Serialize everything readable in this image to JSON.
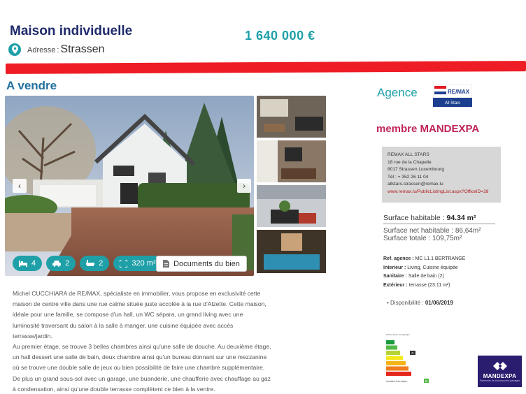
{
  "listing": {
    "title": "Maison individuelle",
    "price": "1 640 000 €",
    "address_label": "Adresse",
    "address_sep": ":",
    "address_value": "Strassen",
    "status": "A vendre"
  },
  "photo_nav": {
    "prev": "‹",
    "next": "›"
  },
  "features": {
    "bedrooms": "4",
    "cars": "2",
    "baths": "2",
    "area": "320 m²"
  },
  "documents_label": "Documents du bien",
  "description": [
    "Michel CUCCHIARA de RE/MAX, spécialiste en immobilier, vous propose en exclusivité cette",
    "maison de centre ville dans une rue calme située juste accolée à la rue d'Alzette. Cette maison,",
    "idéale pour une famille, se compose d'un hall, un WC sépara, un grand living avec une",
    "luminosité traversant du salon à la salle à manger, une cuisine équipée avec accès",
    "terrasse/jardin.",
    "Au premier étage, se trouve 3 belles chambres ainsi qu'une salle de douche. Au deuxième étage,",
    "un hall dessert une salle de bain, deux chambre ainsi qu'un bureau donnant sur une mezzanine",
    "où se trouve une double salle de jeux ou bien possibilité de faire une chambre supplémentaire.",
    "De plus un grand sous-sol avec un garage, une buanderie, une chaufferie avec chauffage au gaz",
    "à condensation, ainsi qu'une double terrasse complètent ce bien à la ventre."
  ],
  "agency": {
    "heading": "Agence",
    "logo_text_top": "RE/MAX",
    "logo_text_bottom": "All Stars",
    "membre": "membre MANDEXPA",
    "lines": [
      "REMAX ALL STARS",
      "18 rue de la Chapelle",
      "8017 Strassen Luxembourg",
      "Tél : + 352 26 11 04",
      "allstars.strassen@remax.lu"
    ],
    "url": "www.remax.lu/PublicListingList.aspx?OfficeID=28"
  },
  "surfaces": {
    "habitable_label": "Surface habitable :",
    "habitable_value": "94.34 m²",
    "net_label": "Surface net habitable : 86,64m²",
    "total_label": "Surface totale : 109,75m²"
  },
  "details": {
    "ref_key": "Ref. agence :",
    "ref_val": "MC L1.1 BERTRANGE",
    "int_key": "Interieur :",
    "int_val": "Living, Cuisine équipée",
    "san_key": "Sanitaire :",
    "san_val": "Salle de bain (2)",
    "ext_key": "Extérieur :",
    "ext_val": "terrasse (23.11 m²)"
  },
  "availability": {
    "label": "• Disponibilité :",
    "value": "01/06/2019"
  },
  "energy": {
    "performance_label": "Performance énergétique",
    "isolation_label": "Isolation thermique",
    "energy_class": "C",
    "isolation_class": "B",
    "colors": [
      "#1a9a3c",
      "#52b848",
      "#b5d334",
      "#f5e81b",
      "#f6b318",
      "#ef7c1b",
      "#e4261c"
    ]
  },
  "mandexpa_logo": {
    "label": "MANDEXPA",
    "sub": "Partenaire de la transaction partagée"
  },
  "colors": {
    "accent": "#1fa0a8",
    "title": "#1f2a6b",
    "sale": "#1f6f9e",
    "membre": "#c0255a",
    "red_bar": "#ee1c24"
  }
}
